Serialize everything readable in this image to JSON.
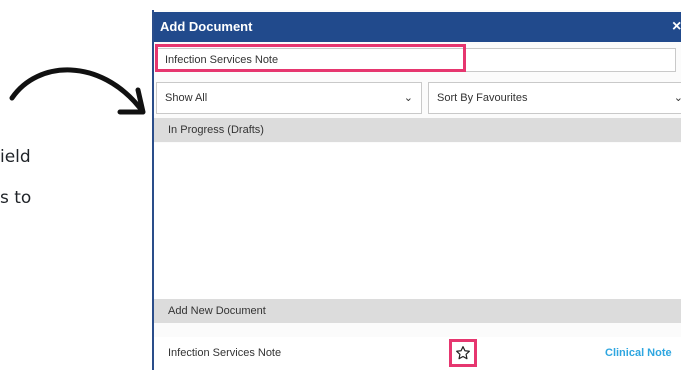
{
  "annotation": {
    "line1": "ield",
    "line2": "s to"
  },
  "dialog": {
    "title": "Add Document",
    "close_label": "×"
  },
  "search": {
    "value": "Infection Services Note",
    "placeholder": ""
  },
  "filters": {
    "show_selected": "Show All",
    "sort_selected": "Sort By Favourites"
  },
  "sections": {
    "drafts_header": "In Progress (Drafts)",
    "new_header": "Add New Document"
  },
  "documents": [
    {
      "name": "Infection Services Note",
      "type": "Clinical Note",
      "favourite": false
    }
  ],
  "colors": {
    "titlebar": "#214a8c",
    "highlight": "#e6366f",
    "link": "#2ea6e0"
  },
  "icons": {
    "arrow": "curved-arrow-icon",
    "star": "star-outline-icon",
    "chevron": "chevron-down-icon",
    "close": "close-icon"
  }
}
